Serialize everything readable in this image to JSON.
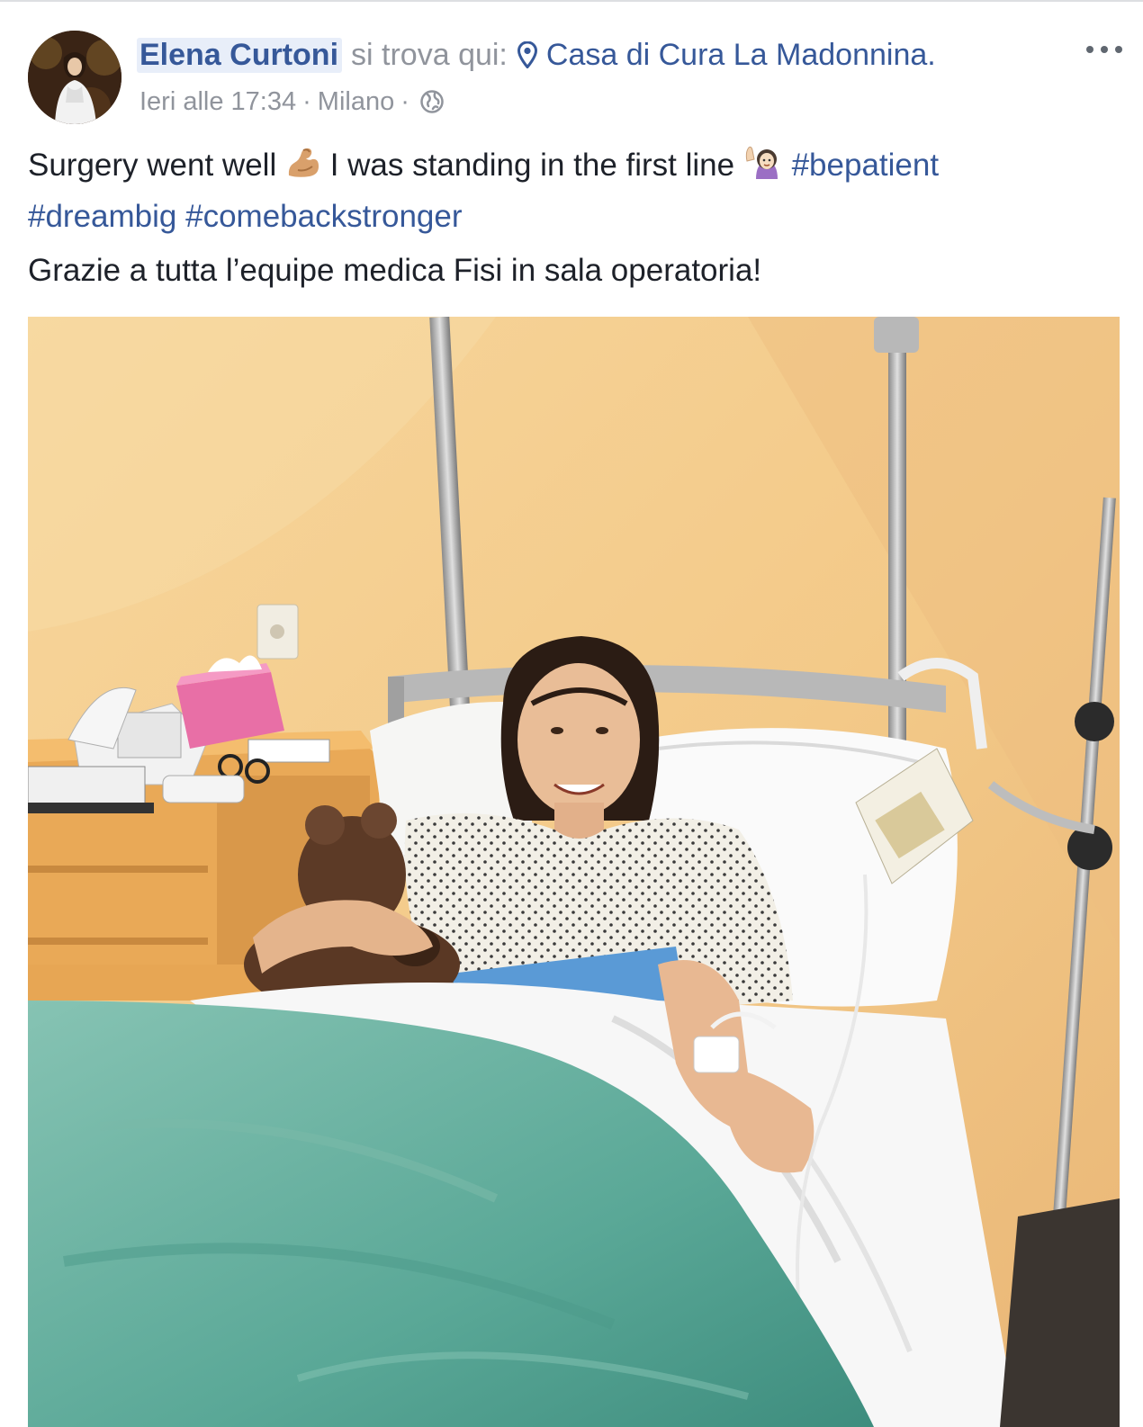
{
  "post": {
    "author": "Elena Curtoni",
    "checkin_text": "si trova qui:",
    "place": "Casa di Cura La Madonnina",
    "place_suffix": ".",
    "timestamp": "Ieri alle 17:34",
    "separator": "·",
    "city": "Milano",
    "privacy_icon": "globe-icon",
    "more_icon": "more-options-icon",
    "text": {
      "part1": "Surgery went well",
      "part2": "I was standing in the first line",
      "hashtags": [
        "#bepatient",
        "#dreambig",
        "#comebackstronger"
      ],
      "line2": "Grazie a tutta l’equipe medica Fisi in sala operatoria!"
    },
    "emojis": [
      "flexed-biceps-emoji",
      "woman-raising-hand-emoji"
    ]
  },
  "colors": {
    "link": "#365899",
    "meta": "#90949c",
    "text": "#1d2129",
    "author_highlight": "#e8eef9"
  }
}
